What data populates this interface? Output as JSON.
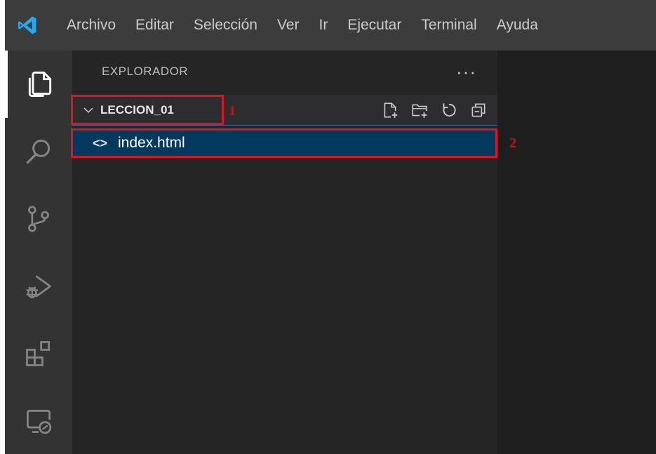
{
  "menu": {
    "items": [
      "Archivo",
      "Editar",
      "Selección",
      "Ver",
      "Ir",
      "Ejecutar",
      "Terminal",
      "Ayuda"
    ]
  },
  "icons": {
    "logo": "vscode-logo-icon",
    "activity": [
      "explorer-icon",
      "search-icon",
      "source-control-icon",
      "run-debug-icon",
      "extensions-icon",
      "remote-explorer-icon"
    ],
    "folder_actions": [
      "new-file-icon",
      "new-folder-icon",
      "refresh-icon",
      "collapse-all-icon"
    ]
  },
  "explorer": {
    "title": "EXPLORADOR",
    "more": "···",
    "folder": "LECCION_01",
    "file_icon": "<>",
    "file": "index.html"
  },
  "annotations": {
    "one": "1",
    "two": "2"
  },
  "colors": {
    "accent": "#007fd4",
    "selection": "#04395e",
    "annotation": "#e0141e",
    "logo": "#23a9f2"
  }
}
